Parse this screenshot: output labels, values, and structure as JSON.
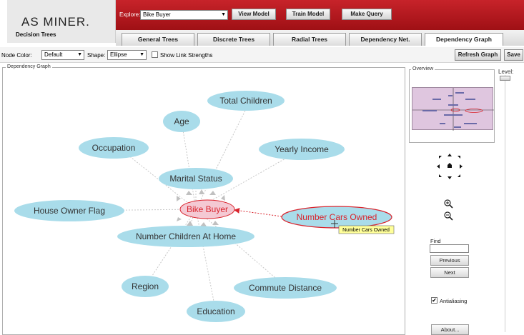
{
  "app": {
    "brand": "AS MINER.",
    "subtitle": "Decision Trees"
  },
  "header": {
    "explore_label": "Explore:",
    "explore_value": "Bike Buyer",
    "buttons": [
      "View Model",
      "Train Model",
      "Make Query"
    ]
  },
  "tabs": [
    "General Trees",
    "Discrete Trees",
    "Radial Trees",
    "Dependency Net.",
    "Dependency Graph"
  ],
  "toolbar": {
    "node_color_label": "Node Color:",
    "node_color_value": "Default",
    "shape_label": "Shape:",
    "shape_value": "Ellipse",
    "show_link_label": "Show Link Strengths",
    "refresh_label": "Refresh Graph",
    "save_label": "Save"
  },
  "graph": {
    "panel_title": "Dependency Graph",
    "center": "Bike Buyer",
    "selected": "Number Cars Owned",
    "tooltip": "Number Cars Owned",
    "nodes": [
      "Total Children",
      "Age",
      "Occupation",
      "Yearly Income",
      "Marital Status",
      "House Owner Flag",
      "Number Cars Owned",
      "Number Children At Home",
      "Region",
      "Commute Distance",
      "Education"
    ]
  },
  "sidebar": {
    "overview_title": "Overview",
    "level_label": "Level:",
    "find_label": "Find",
    "find_value": "",
    "previous_label": "Previous",
    "next_label": "Next",
    "antialiasing_label": "Antialiasing",
    "antialiasing_checked": true,
    "about_label": "About..."
  },
  "colors": {
    "header_red": "#b71c22",
    "node_fill": "#a9dcea",
    "center_fill": "#f4c9d3",
    "center_border": "#d9232c",
    "center_text": "#d9232c",
    "tooltip_bg": "#ffff99",
    "overview_bg": "#dfc6df"
  }
}
